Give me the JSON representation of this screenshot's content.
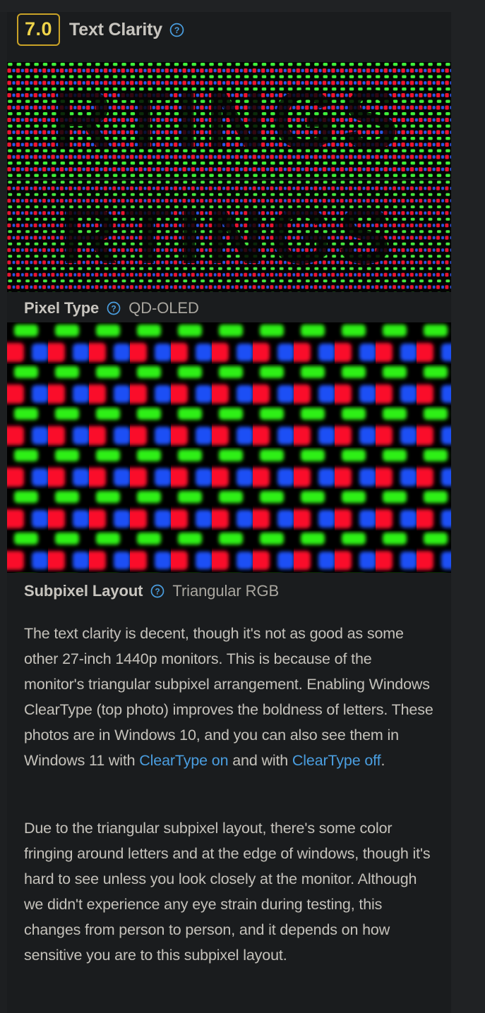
{
  "section": {
    "score": "7.0",
    "title": "Text Clarity",
    "help_icon": "help-circle-icon"
  },
  "photos": [
    {
      "name": "text-clarity-cleartype-on-photo",
      "caption": "Macro photo of subpixels rendering the word RTINGS with Windows ClearType enabled",
      "word": "RTINGS"
    },
    {
      "name": "text-clarity-cleartype-off-photo",
      "caption": "Macro photo of subpixels rendering the word RTINGS with Windows ClearType disabled",
      "word": "RTINGS"
    },
    {
      "name": "subpixel-layout-photo",
      "caption": "Macro photo of the QD-OLED triangular RGB subpixel layout"
    }
  ],
  "specs": [
    {
      "label": "Pixel Type",
      "value": "QD-OLED",
      "help_icon": "help-circle-icon"
    },
    {
      "label": "Subpixel Layout",
      "value": "Triangular RGB",
      "help_icon": "help-circle-icon"
    }
  ],
  "paragraphs": {
    "p1_part1": "The text clarity is decent, though it's not as good as some other 27-inch 1440p monitors. This is because of the monitor's triangular subpixel arrangement. Enabling Windows ClearType (top photo) improves the boldness of letters. These photos are in Windows 10, and you can also see them in Windows 11 with ",
    "p1_link1": "ClearType on",
    "p1_part2": " and with ",
    "p1_link2": "ClearType off",
    "p1_part3": ".",
    "p2": "Due to the triangular subpixel layout, there's some color fringing around letters and at the edge of windows, though it's hard to see unless you look closely at the monitor. Although we didn't experience any eye strain during testing, this changes from person to person, and it depends on how sensitive you are to this subpixel layout."
  },
  "colors": {
    "page_background": "#1d1f21",
    "panel_background": "#1a1c1e",
    "gutter_background": "#202224",
    "score_border": "#c9a227",
    "score_text": "#f0d44a",
    "heading_text": "#c8c5bf",
    "body_text": "#c5c2bb",
    "link_text": "#4a9ee0",
    "help_icon": "#4a9ee0"
  }
}
